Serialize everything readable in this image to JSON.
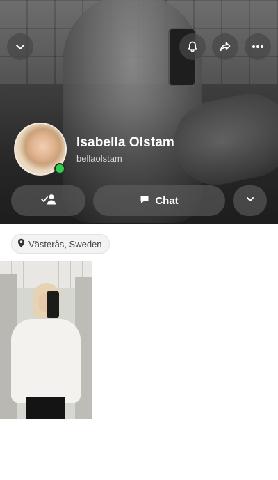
{
  "profile": {
    "display_name": "Isabella Olstam",
    "username": "bellaolstam",
    "online": true,
    "status_color": "#2fcf4a"
  },
  "top_bar": {
    "collapse_icon": "chevron-down-icon",
    "notifications_icon": "bell-icon",
    "share_icon": "share-arrow-icon",
    "more_icon": "more-dots-icon"
  },
  "actions": {
    "friend_icon": "person-check-icon",
    "chat_label": "Chat",
    "chat_icon": "chat-bubble-icon",
    "more_icon": "chevron-down-icon"
  },
  "location": {
    "label": "Västerås, Sweden",
    "icon": "location-pin-icon"
  },
  "media": {
    "items_shown": 1
  }
}
